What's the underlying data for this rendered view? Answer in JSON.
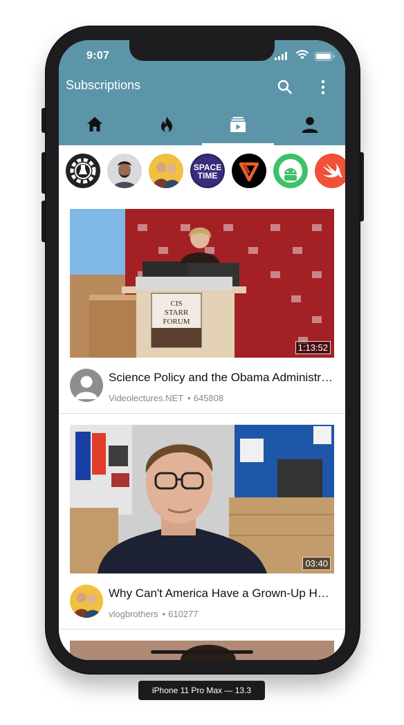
{
  "status_bar": {
    "time": "9:07"
  },
  "app_bar": {
    "title": "Subscriptions"
  },
  "colors": {
    "primary": "#5c95a8",
    "tab_indicator": "#ffffff"
  },
  "tabs": [
    {
      "icon": "home-icon"
    },
    {
      "icon": "fire-icon"
    },
    {
      "icon": "subscriptions-icon",
      "selected": true
    },
    {
      "icon": "person-icon"
    }
  ],
  "channels": [
    {
      "icon": "channel-gear-logo"
    },
    {
      "icon": "channel-avatar-man"
    },
    {
      "icon": "channel-avatar-brothers"
    },
    {
      "icon": "channel-space-time",
      "text": "SPACE TIME"
    },
    {
      "icon": "channel-veritasium-logo"
    },
    {
      "icon": "channel-android-logo"
    },
    {
      "icon": "channel-swift-logo"
    }
  ],
  "videos": [
    {
      "title": "Science Policy and the Obama Administr…",
      "channel": "Videolectures.NET",
      "views": "645808",
      "duration": "1:13:52",
      "podium_text": "CIS STARR FORUM"
    },
    {
      "title": "Why Can't America Have a Grown-Up H…",
      "channel": "vlogbrothers",
      "views": "610277",
      "duration": "03:40"
    }
  ],
  "device_label": "iPhone 11 Pro Max — 13.3"
}
